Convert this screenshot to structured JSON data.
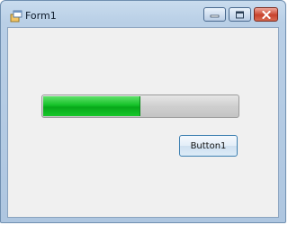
{
  "window": {
    "title": "Form1",
    "controls": {
      "minimize": "minimize-icon",
      "maximize": "maximize-icon",
      "close": "close-icon"
    }
  },
  "form": {
    "progress_bar": {
      "value": 0.5,
      "color": "#14c227"
    },
    "button1_label": "Button1"
  },
  "colors": {
    "titlebar": "#bcd3ea",
    "client_background": "#f0f0f0",
    "close_button": "#c8432d",
    "accent": "#3c7fb1"
  }
}
